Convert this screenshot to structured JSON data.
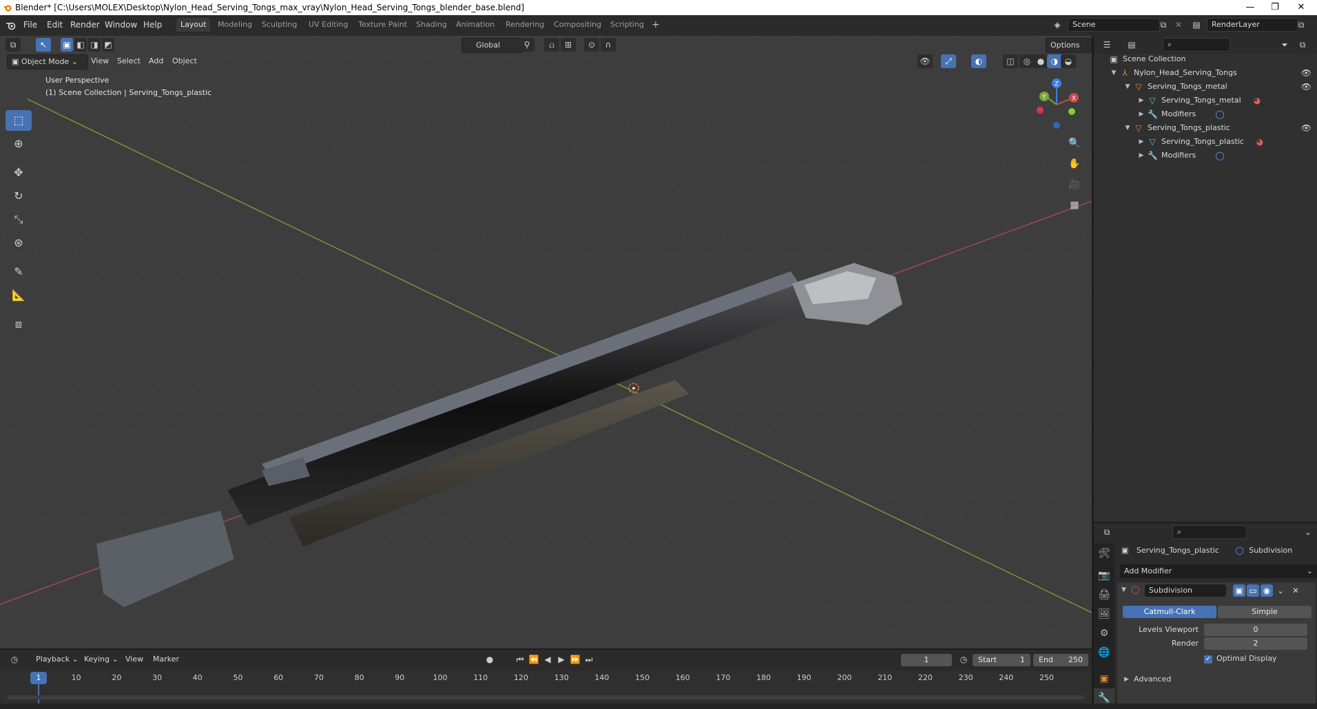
{
  "window": {
    "title": "Blender* [C:\\Users\\MOLEX\\Desktop\\Nylon_Head_Serving_Tongs_max_vray\\Nylon_Head_Serving_Tongs_blender_base.blend]",
    "minimize": "—",
    "restore": "❐",
    "close": "✕"
  },
  "menu": {
    "items": [
      "File",
      "Edit",
      "Render",
      "Window",
      "Help"
    ]
  },
  "workspaces": [
    "Layout",
    "Modeling",
    "Sculpting",
    "UV Editing",
    "Texture Paint",
    "Shading",
    "Animation",
    "Rendering",
    "Compositing",
    "Scripting"
  ],
  "active_workspace": "Layout",
  "scene": {
    "name": "Scene",
    "render_layer": "RenderLayer"
  },
  "viewport": {
    "mode": "Object Mode",
    "header_menus": [
      "View",
      "Select",
      "Add",
      "Object"
    ],
    "transform_orientation": "Global",
    "options_label": "Options",
    "perspective_label": "User Perspective",
    "collection_label": "(1) Scene Collection | Serving_Tongs_plastic",
    "gizmo_axes": {
      "x": "X",
      "y": "Y",
      "z": "Z"
    }
  },
  "outliner": {
    "root": "Scene Collection",
    "rows": [
      {
        "label": "Nylon_Head_Serving_Tongs",
        "icon": "armature-icon"
      },
      {
        "label": "Serving_Tongs_metal",
        "icon": "object-icon"
      },
      {
        "label": "Serving_Tongs_metal",
        "icon": "mesh-icon"
      },
      {
        "label": "Modifiers",
        "icon": "wrench-icon"
      },
      {
        "label": "Serving_Tongs_plastic",
        "icon": "object-icon"
      },
      {
        "label": "Serving_Tongs_plastic",
        "icon": "mesh-icon"
      },
      {
        "label": "Modifiers",
        "icon": "wrench-icon"
      }
    ]
  },
  "properties": {
    "object_name": "Serving_Tongs_plastic",
    "modifier_context": "Subdivision",
    "add_modifier": "Add Modifier",
    "modifier_name": "Subdivision",
    "tabs": [
      "Catmull-Clark",
      "Simple"
    ],
    "active_tab": "Catmull-Clark",
    "levels_viewport_label": "Levels Viewport",
    "levels_viewport": "0",
    "render_label": "Render",
    "render_value": "2",
    "optimal_display_label": "Optimal Display",
    "optimal_display": true,
    "advanced_label": "Advanced"
  },
  "timeline": {
    "menus": [
      "Playback",
      "Keying",
      "View",
      "Marker"
    ],
    "current_frame": "1",
    "start_label": "Start",
    "start": "1",
    "end_label": "End",
    "end": "250",
    "ticks": [
      "1",
      "10",
      "20",
      "30",
      "40",
      "50",
      "60",
      "70",
      "80",
      "90",
      "100",
      "110",
      "120",
      "130",
      "140",
      "150",
      "160",
      "170",
      "180",
      "190",
      "200",
      "210",
      "220",
      "230",
      "240",
      "250"
    ]
  },
  "colors": {
    "accent": "#4772b3",
    "x_axis": "#c94a4a",
    "y_axis": "#7aa83a",
    "z_axis": "#3f7ed8"
  }
}
